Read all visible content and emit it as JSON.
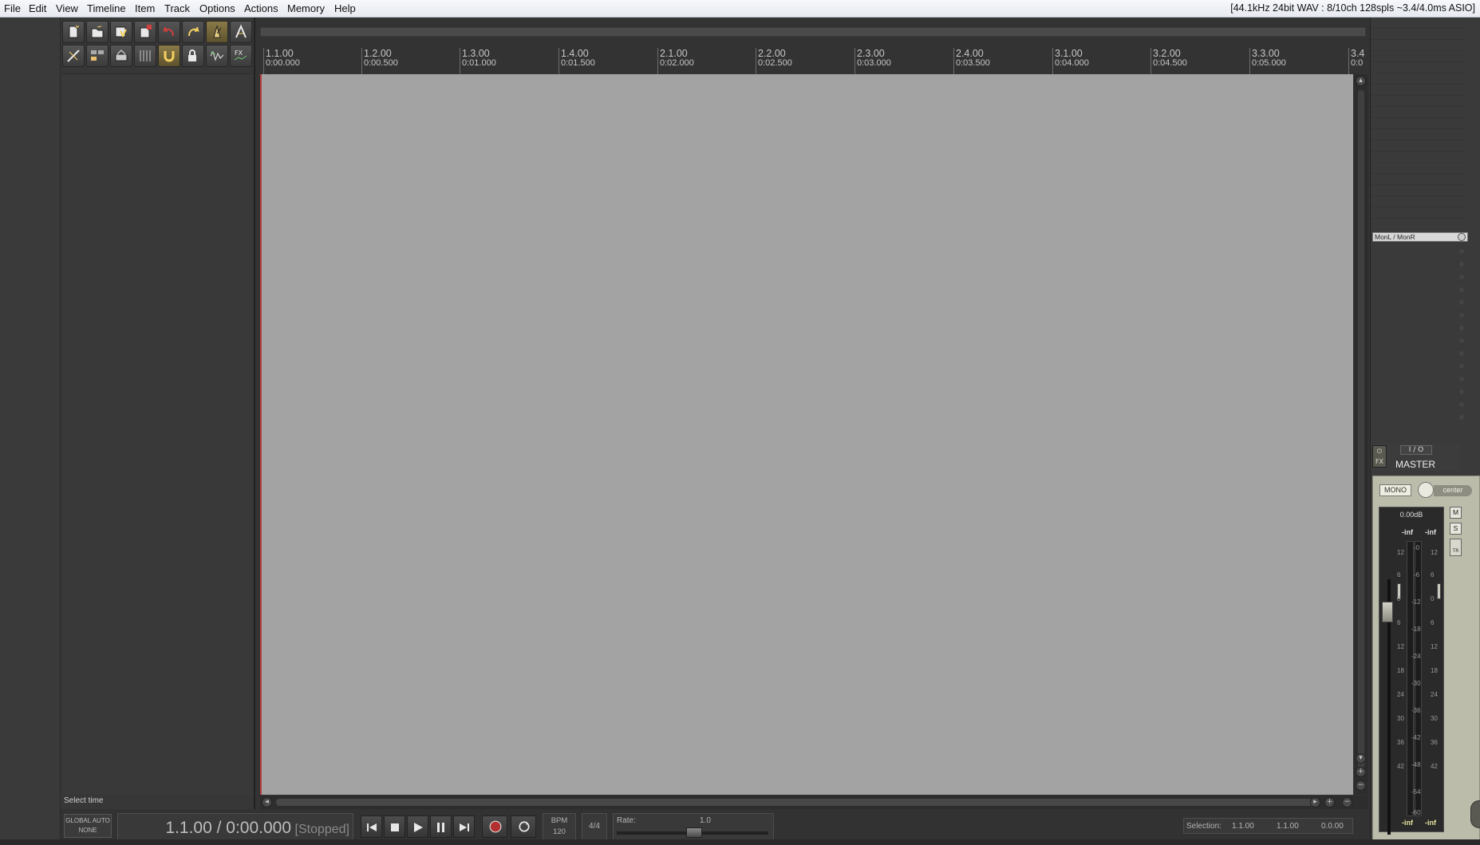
{
  "menu": [
    "File",
    "Edit",
    "View",
    "Timeline",
    "Item",
    "Track",
    "Options",
    "Actions",
    "Memory",
    "Help"
  ],
  "status": "[44.1kHz 24bit WAV : 8/10ch 128spls ~3.4/4.0ms ASIO]",
  "toolbar": {
    "icons": [
      "new-project-icon",
      "open-project-icon",
      "save-project-icon",
      "project-settings-icon",
      "undo-icon",
      "redo-icon",
      "metronome-icon",
      "ripple-edit-icon",
      "grid-icon",
      "snap-icon",
      "move-envelope-icon",
      "lock-icon",
      "crossfade-icon",
      "auto-crossfade-icon",
      "fx-icon",
      "envelope-points-icon"
    ]
  },
  "ruler": {
    "ticks": [
      {
        "m": "1.1.00",
        "t": "0:00.000"
      },
      {
        "m": "1.2.00",
        "t": "0:00.500"
      },
      {
        "m": "1.3.00",
        "t": "0:01.000"
      },
      {
        "m": "1.4.00",
        "t": "0:01.500"
      },
      {
        "m": "2.1.00",
        "t": "0:02.000"
      },
      {
        "m": "2.2.00",
        "t": "0:02.500"
      },
      {
        "m": "2.3.00",
        "t": "0:03.000"
      },
      {
        "m": "2.4.00",
        "t": "0:03.500"
      },
      {
        "m": "3.1.00",
        "t": "0:04.000"
      },
      {
        "m": "3.2.00",
        "t": "0:04.500"
      },
      {
        "m": "3.3.00",
        "t": "0:05.000"
      },
      {
        "m": "3.4",
        "t": "0:0"
      }
    ]
  },
  "tcp": {
    "status": "Select time"
  },
  "transport": {
    "global_auto_line1": "GLOBAL AUTO",
    "global_auto_line2": "NONE",
    "position": "1.1.00 / 0:00.000",
    "state": "[Stopped]",
    "bpm_label": "BPM",
    "bpm": "120",
    "time_sig": "4/4",
    "rate_label": "Rate:",
    "rate": "1.0",
    "selection_label": "Selection:",
    "sel_start": "1.1.00",
    "sel_end": "1.1.00",
    "sel_len": "0.0.00"
  },
  "master": {
    "routing": "MonL / MonR",
    "io": "I / O",
    "fx": "FX",
    "name": "MASTER",
    "mono": "MONO",
    "pan": "center",
    "volume": "0.00dB",
    "peak_left": "-inf",
    "peak_right": "-inf",
    "mute": "M",
    "solo": "S",
    "tr": "TR",
    "scale_outer": [
      "12",
      "6",
      "0",
      "6",
      "12",
      "18",
      "24",
      "30",
      "36",
      "42"
    ],
    "scale_inner": [
      "-0",
      "-6",
      "-12",
      "-18",
      "-24",
      "-30",
      "-36",
      "-42",
      "-48",
      "-54",
      "-60"
    ]
  }
}
